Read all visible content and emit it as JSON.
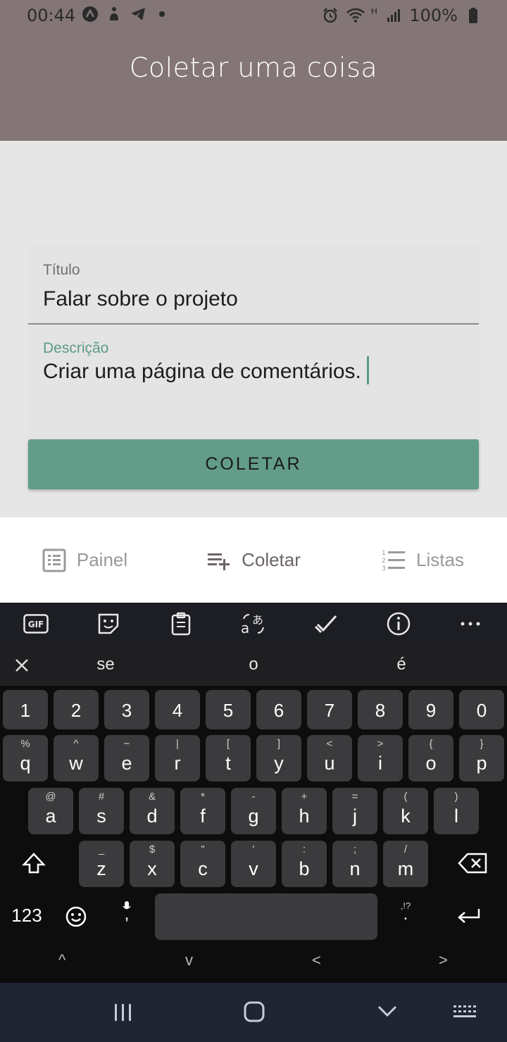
{
  "status_bar": {
    "time": "00:44",
    "battery": "100%",
    "network_type": "H",
    "left_icons": [
      "app-a-icon",
      "accessibility-icon",
      "telegram-icon",
      "dot-icon"
    ],
    "right_icons": [
      "alarm-icon",
      "wifi-icon",
      "signal-icon",
      "battery-icon"
    ]
  },
  "header": {
    "title": "Coletar uma coisa"
  },
  "form": {
    "titulo_label": "Título",
    "titulo_value": "Falar sobre o projeto",
    "descricao_label": "Descrição",
    "descricao_value": "Criar uma página de comentários.",
    "submit_label": "COLETAR"
  },
  "bottom_nav": {
    "items": [
      {
        "label": "Painel",
        "icon": "dashboard-icon",
        "active": false
      },
      {
        "label": "Coletar",
        "icon": "playlist-add-icon",
        "active": true
      },
      {
        "label": "Listas",
        "icon": "list-numbered-icon",
        "active": false
      }
    ]
  },
  "keyboard": {
    "toolbar": [
      "gif-icon",
      "sticker-icon",
      "clipboard-icon",
      "translate-icon",
      "edit-icon",
      "info-icon",
      "more-icon"
    ],
    "suggestions": [
      "se",
      "o",
      "é"
    ],
    "row_numbers": [
      "1",
      "2",
      "3",
      "4",
      "5",
      "6",
      "7",
      "8",
      "9",
      "0"
    ],
    "row1": [
      {
        "k": "q",
        "s": "%"
      },
      {
        "k": "w",
        "s": "^"
      },
      {
        "k": "e",
        "s": "~"
      },
      {
        "k": "r",
        "s": "|"
      },
      {
        "k": "t",
        "s": "["
      },
      {
        "k": "y",
        "s": "]"
      },
      {
        "k": "u",
        "s": "<"
      },
      {
        "k": "i",
        "s": ">"
      },
      {
        "k": "o",
        "s": "{"
      },
      {
        "k": "p",
        "s": "}"
      }
    ],
    "row2": [
      {
        "k": "a",
        "s": "@"
      },
      {
        "k": "s",
        "s": "#"
      },
      {
        "k": "d",
        "s": "&"
      },
      {
        "k": "f",
        "s": "*"
      },
      {
        "k": "g",
        "s": "-"
      },
      {
        "k": "h",
        "s": "+"
      },
      {
        "k": "j",
        "s": "="
      },
      {
        "k": "k",
        "s": "("
      },
      {
        "k": "l",
        "s": ")"
      }
    ],
    "row3": [
      {
        "k": "z",
        "s": "_"
      },
      {
        "k": "x",
        "s": "$"
      },
      {
        "k": "c",
        "s": "\""
      },
      {
        "k": "v",
        "s": "'"
      },
      {
        "k": "b",
        "s": ":"
      },
      {
        "k": "n",
        "s": ";"
      },
      {
        "k": "m",
        "s": "/"
      }
    ],
    "mode_key": "123",
    "comma_key": ",",
    "period_key": ".",
    "period_sup": ",!?",
    "nav_arrows": [
      "^",
      "v",
      "<",
      ">"
    ]
  }
}
